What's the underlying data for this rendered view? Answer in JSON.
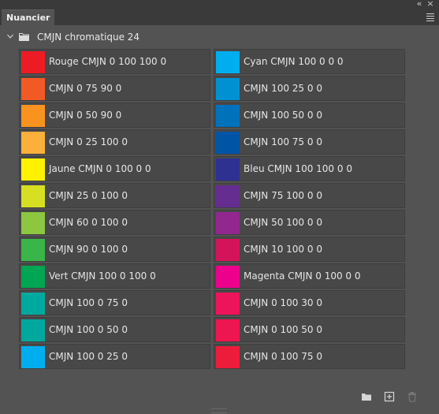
{
  "panel": {
    "tab_title": "Nuancier"
  },
  "group": {
    "name": "CMJN chromatique 24"
  },
  "swatches_left": [
    {
      "label": "Rouge CMJN 0 100 100 0",
      "color": "#ed1c24"
    },
    {
      "label": "CMJN 0 75 90 0",
      "color": "#f15a24"
    },
    {
      "label": "CMJN 0 50 90 0",
      "color": "#f7931e"
    },
    {
      "label": "CMJN 0 25 100 0",
      "color": "#fbb03b"
    },
    {
      "label": "Jaune CMJN 0 100 0 0",
      "color": "#fff200"
    },
    {
      "label": "CMJN 25 0 100 0",
      "color": "#d7df23"
    },
    {
      "label": "CMJN 60 0 100 0",
      "color": "#8dc63f"
    },
    {
      "label": "CMJN 90 0 100 0",
      "color": "#39b54a"
    },
    {
      "label": "Vert CMJN 100 0 100 0",
      "color": "#00a651"
    },
    {
      "label": "CMJN 100 0 75 0",
      "color": "#00a99d"
    },
    {
      "label": "CMJN 100 0 50 0",
      "color": "#00a79d"
    },
    {
      "label": "CMJN 100 0 25 0",
      "color": "#00aeef"
    }
  ],
  "swatches_right": [
    {
      "label": "Cyan CMJN 100 0 0 0",
      "color": "#00aeef"
    },
    {
      "label": "CMJN 100 25 0 0",
      "color": "#0091d2"
    },
    {
      "label": "CMJN 100 50 0 0",
      "color": "#0072bc"
    },
    {
      "label": "CMJN 100 75 0 0",
      "color": "#0054a6"
    },
    {
      "label": "Bleu CMJN 100 100 0 0",
      "color": "#2e3192"
    },
    {
      "label": "CMJN 75 100 0 0",
      "color": "#662d91"
    },
    {
      "label": "CMJN 50 100 0 0",
      "color": "#92278f"
    },
    {
      "label": "CMJN 10 100 0 0",
      "color": "#d4145a"
    },
    {
      "label": "Magenta CMJN 0 100 0 0",
      "color": "#ec008c"
    },
    {
      "label": "CMJN 0 100 30 0",
      "color": "#ed145b"
    },
    {
      "label": "CMJN 0 100 50 0",
      "color": "#ed1650"
    },
    {
      "label": "CMJN 0 100 75 0",
      "color": "#ed1c3a"
    }
  ],
  "icons": {
    "collapse": "double-chevron-left-icon",
    "close_panel": "close-icon",
    "panel_menu": "hamburger-menu-icon",
    "group_toggle": "chevron-down-icon",
    "group_folder": "folder-icon",
    "new_group": "new-folder-icon",
    "new_swatch": "new-swatch-icon",
    "delete": "trash-icon"
  },
  "colors": {
    "panel_bg": "#535353",
    "swatch_bg": "#484848",
    "text": "#e6e6e6"
  }
}
